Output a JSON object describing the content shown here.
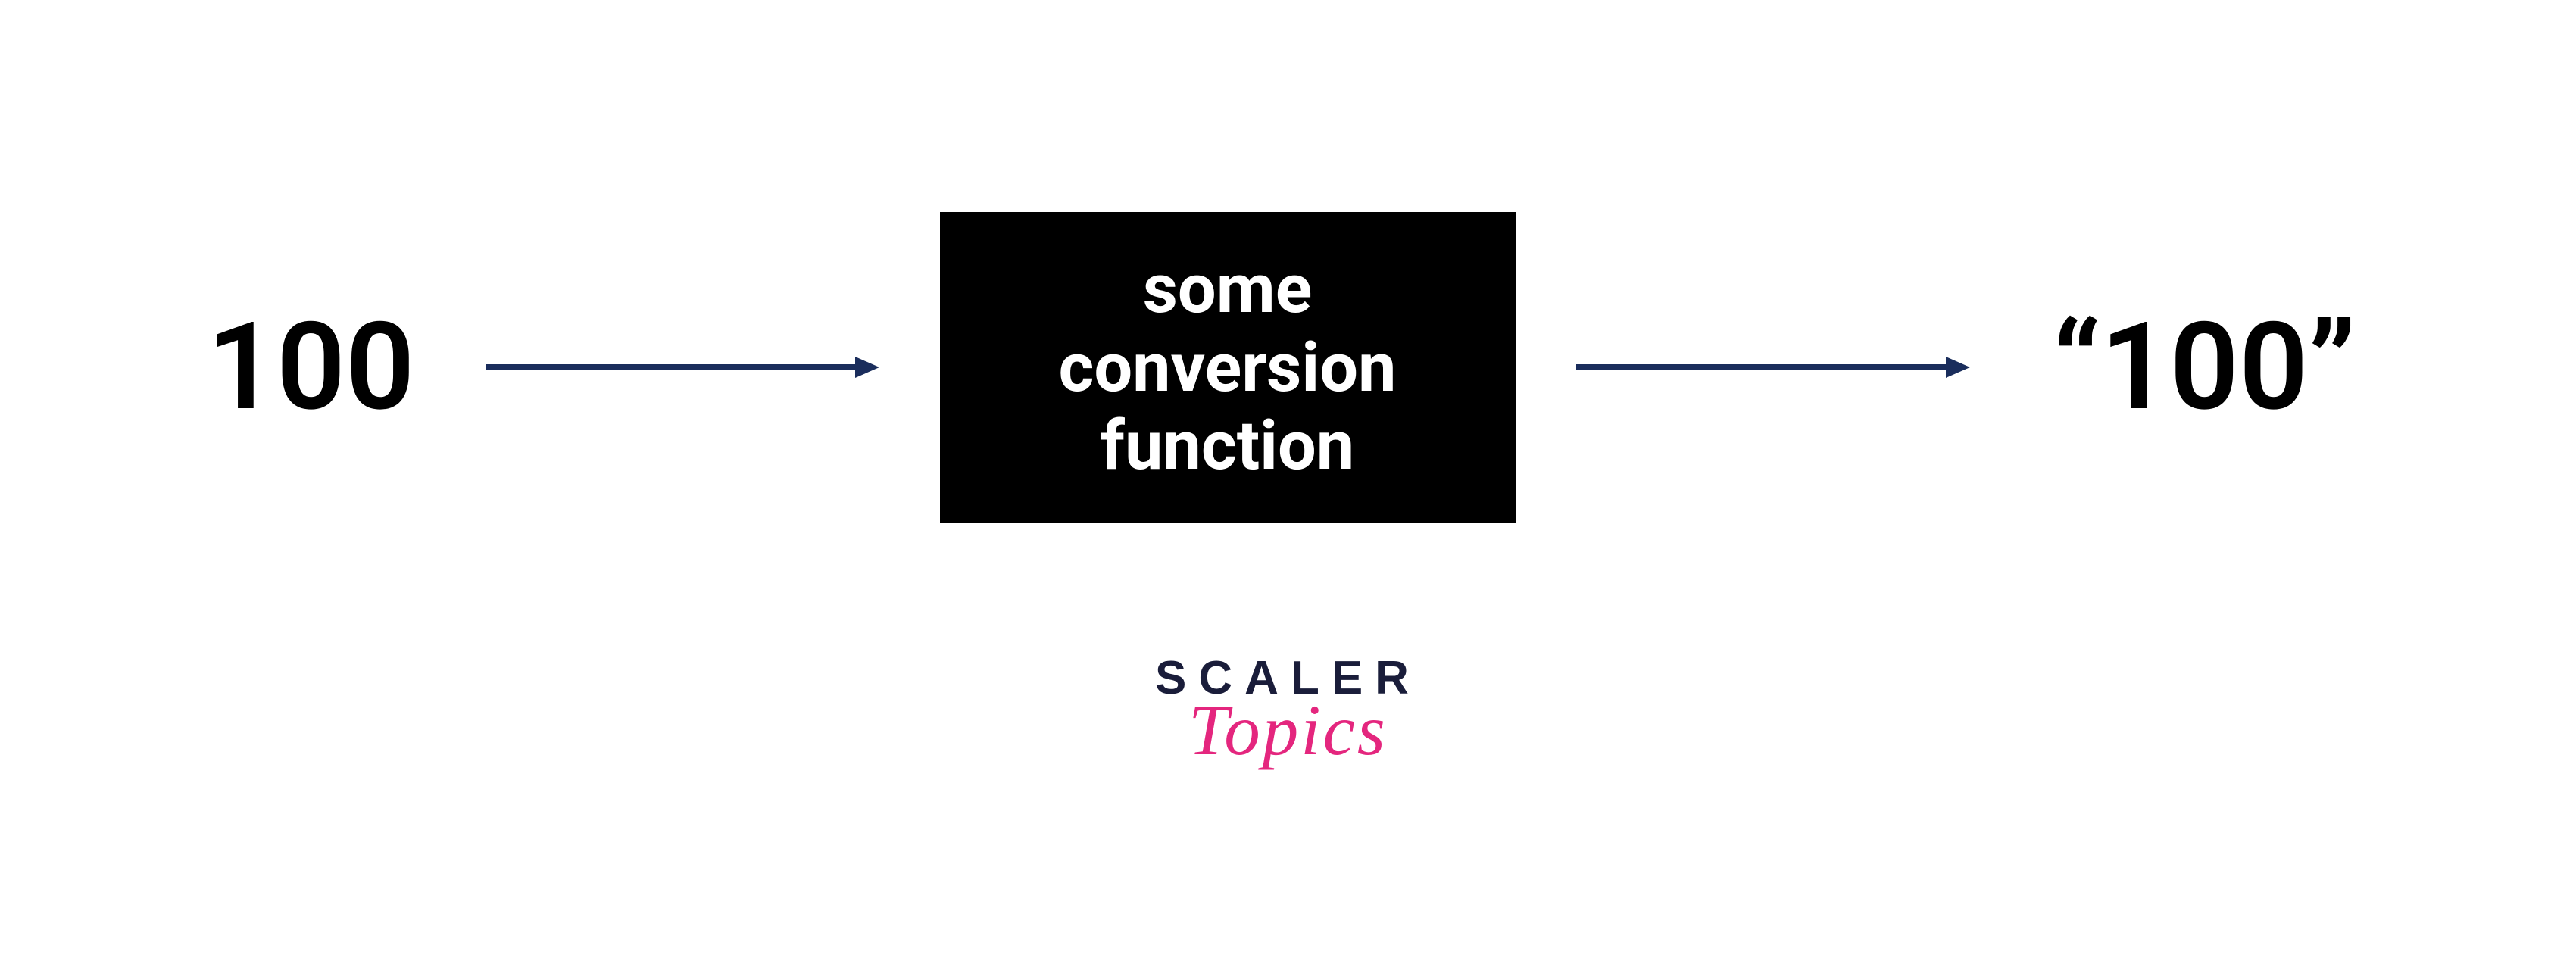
{
  "diagram": {
    "input": "100",
    "box_line1": "some",
    "box_line2": "conversion",
    "box_line3": "function",
    "output": "“100”"
  },
  "logo": {
    "top": "SCALER",
    "bottom": "Topics"
  },
  "colors": {
    "arrow": "#1a2d5c",
    "box_bg": "#000000",
    "box_fg": "#ffffff",
    "logo_top": "#1a1d3a",
    "logo_bottom": "#e4267e"
  }
}
